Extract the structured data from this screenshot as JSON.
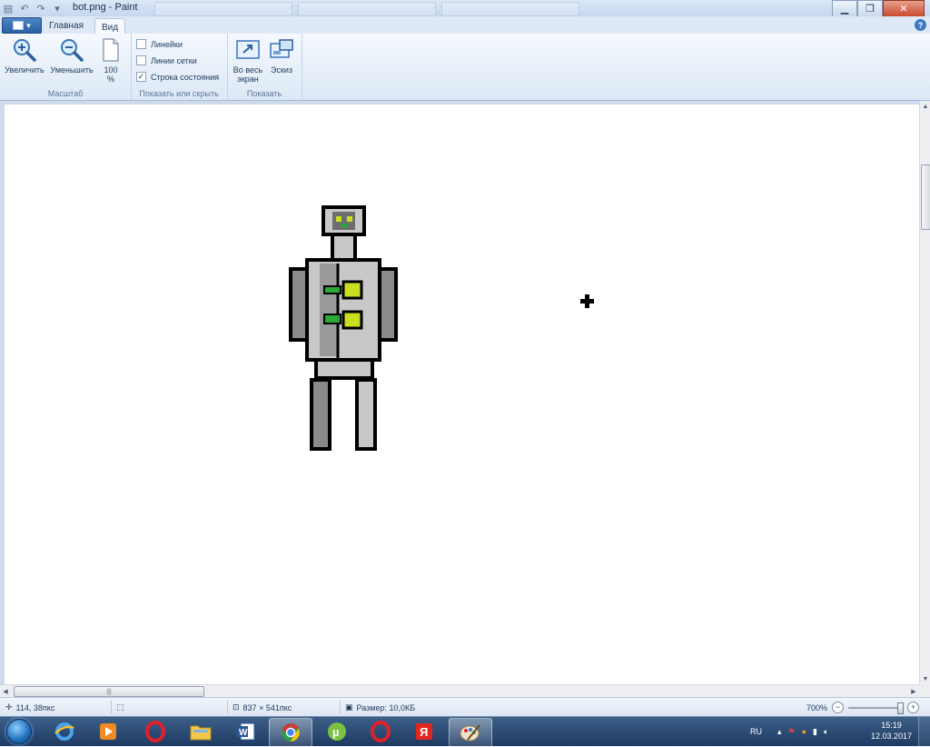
{
  "window": {
    "title": "bot.png - Paint",
    "minimize": "▁",
    "maximize": "❐",
    "close": "✕"
  },
  "ribbon_tabs": {
    "home": "Главная",
    "view": "Вид",
    "help": "?"
  },
  "zoom_group": {
    "label": "Масштаб",
    "zoom_in": "Увеличить",
    "zoom_out": "Уменьшить",
    "zoom_100_line1": "100",
    "zoom_100_line2": "%"
  },
  "show_hide_group": {
    "label": "Показать или скрыть",
    "rulers": {
      "label": "Линейки",
      "checked": false
    },
    "gridlines": {
      "label": "Линии сетки",
      "checked": false
    },
    "statusbar": {
      "label": "Строка состояния",
      "checked": true,
      "mark": "✓"
    }
  },
  "display_group": {
    "label": "Показать",
    "fullscreen_line1": "Во весь",
    "fullscreen_line2": "экран",
    "thumbnail": "Эскиз"
  },
  "status": {
    "cursor_pos": "114, 38пкс",
    "image_size": "837 × 541пкс",
    "file_size": "Размер: 10,0КБ",
    "zoom": "700%",
    "zoom_minus": "−",
    "zoom_plus": "+"
  },
  "taskbar": {
    "lang": "RU",
    "time": "15:19",
    "date": "12.03.2017"
  },
  "colors": {
    "robot_light": "#c8c8c8",
    "robot_dark": "#8a8a8a",
    "robot_outline": "#000000",
    "accent_yellow": "#c8e020",
    "accent_green": "#2aa838"
  }
}
